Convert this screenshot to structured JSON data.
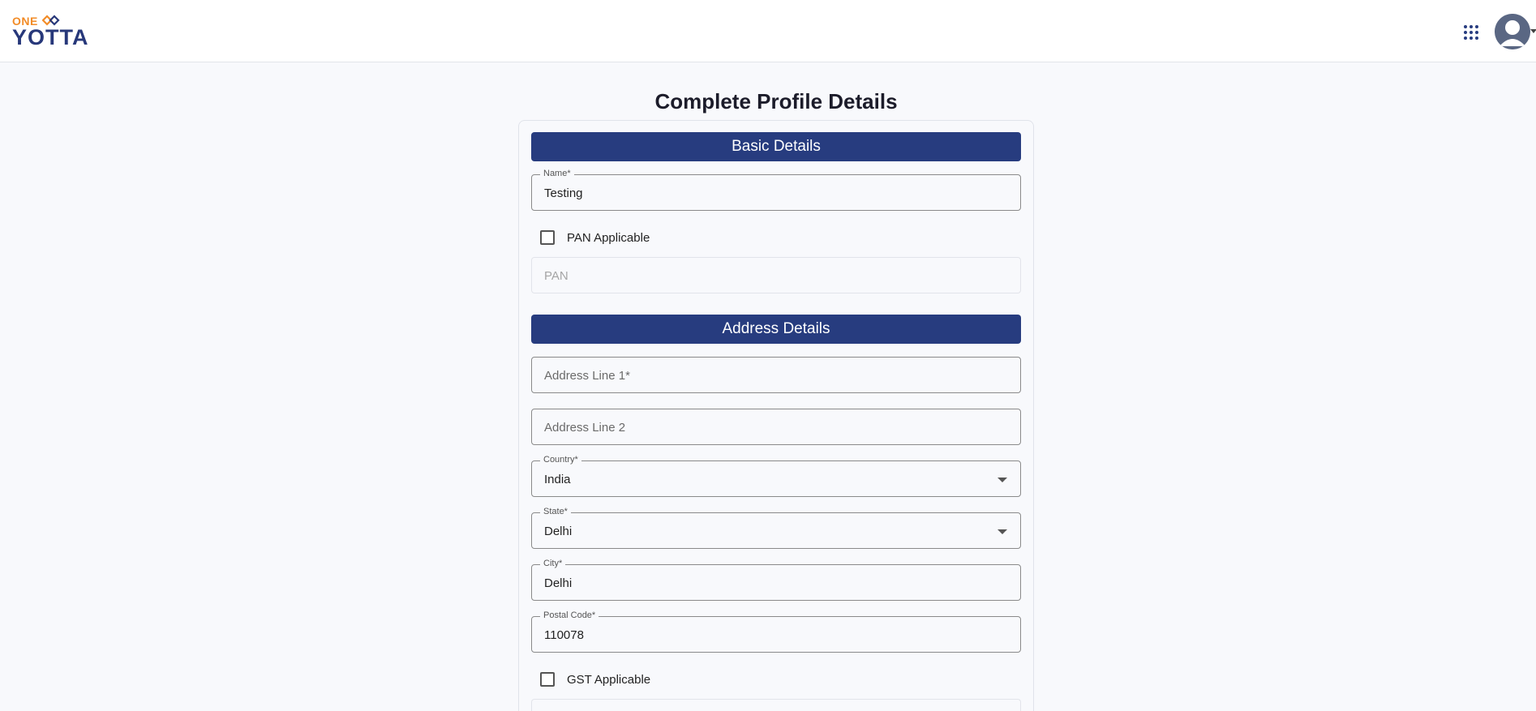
{
  "brand": {
    "logo_top": "ONE",
    "logo_main": "YOTTA",
    "color_orange": "#f28c28",
    "color_navy": "#27387a"
  },
  "header": {
    "apps_icon": "grid-apps-icon",
    "avatar_icon": "user-avatar-icon"
  },
  "page": {
    "title": "Complete Profile Details"
  },
  "basic": {
    "header": "Basic Details",
    "name_label": "Name*",
    "name_value": "Testing",
    "pan_checkbox_label": "PAN Applicable",
    "pan_placeholder": "PAN"
  },
  "address": {
    "header": "Address Details",
    "line1_placeholder": "Address Line 1*",
    "line2_placeholder": "Address Line 2",
    "country_label": "Country*",
    "country_value": "India",
    "state_label": "State*",
    "state_value": "Delhi",
    "city_label": "City*",
    "city_value": "Delhi",
    "postal_label": "Postal Code*",
    "postal_value": "110078",
    "gst_checkbox_label": "GST Applicable"
  },
  "colors": {
    "section_header_bg": "#273c7f",
    "page_bg": "#f8f9fc"
  }
}
